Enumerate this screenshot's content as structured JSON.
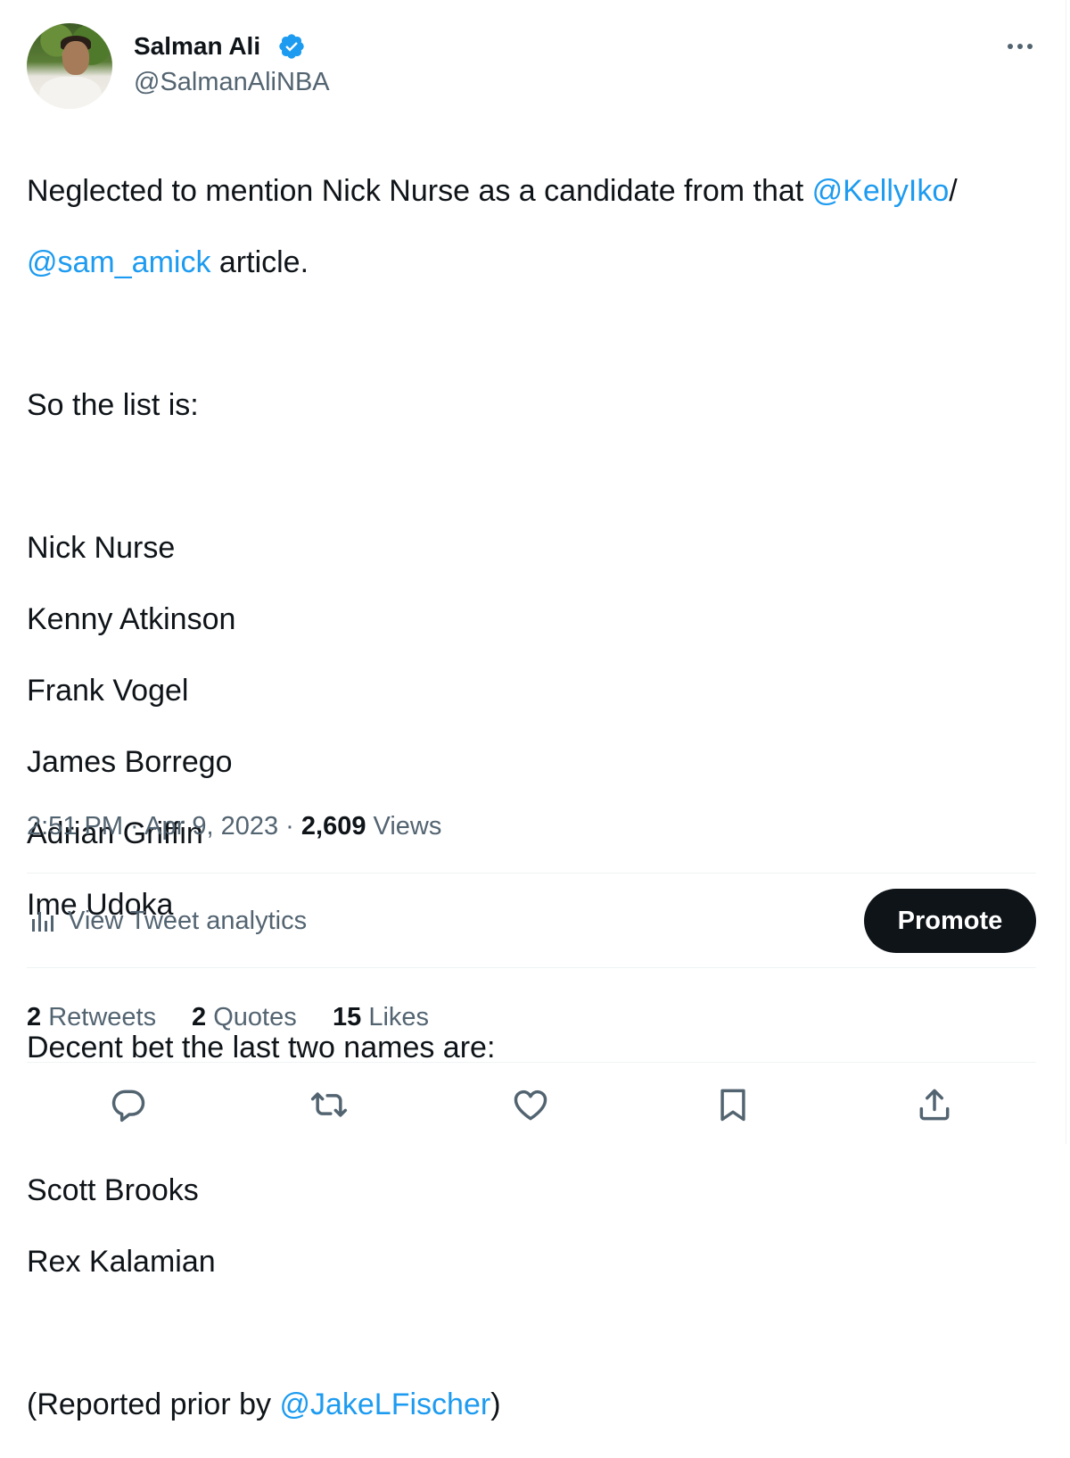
{
  "author": {
    "display_name": "Salman Ali",
    "handle": "@SalmanAliNBA",
    "verified": true,
    "verified_color": "#1d9bf0"
  },
  "tweet": {
    "line1_text": "Neglected to mention Nick Nurse as a candidate from that ",
    "line1_mention": "@KellyIko",
    "line1_suffix": "/",
    "line2_mention": "@sam_amick",
    "line2_text": " article.",
    "list_intro": "So the list is:",
    "candidates": [
      "Nick Nurse",
      "Kenny Atkinson",
      "Frank Vogel",
      "James Borrego",
      "Adrian Griffin",
      "Ime Udoka"
    ],
    "bet_intro": "Decent bet the last two names are:",
    "bet_names": [
      "Scott Brooks",
      "Rex Kalamian"
    ],
    "credit_prefix": "(Reported prior by ",
    "credit_mention": "@JakeLFischer",
    "credit_suffix": ")"
  },
  "meta": {
    "time": "2:51 PM",
    "separator": " · ",
    "date": "Apr 9, 2023",
    "views_count": "2,609",
    "views_label": " Views"
  },
  "analytics": {
    "label": "View Tweet analytics",
    "icon": "bar-chart-icon"
  },
  "promote": {
    "label": "Promote"
  },
  "stats": {
    "retweets_count": "2",
    "retweets_label": " Retweets",
    "quotes_count": "2",
    "quotes_label": " Quotes",
    "likes_count": "15",
    "likes_label": " Likes"
  },
  "actions": {
    "icons": [
      "reply-icon",
      "retweet-icon",
      "like-icon",
      "bookmark-icon",
      "share-icon"
    ]
  },
  "colors": {
    "text": "#0f1419",
    "secondary": "#536471",
    "link": "#1d9bf0",
    "divider": "#eff3f4",
    "button_bg": "#0f1419"
  }
}
